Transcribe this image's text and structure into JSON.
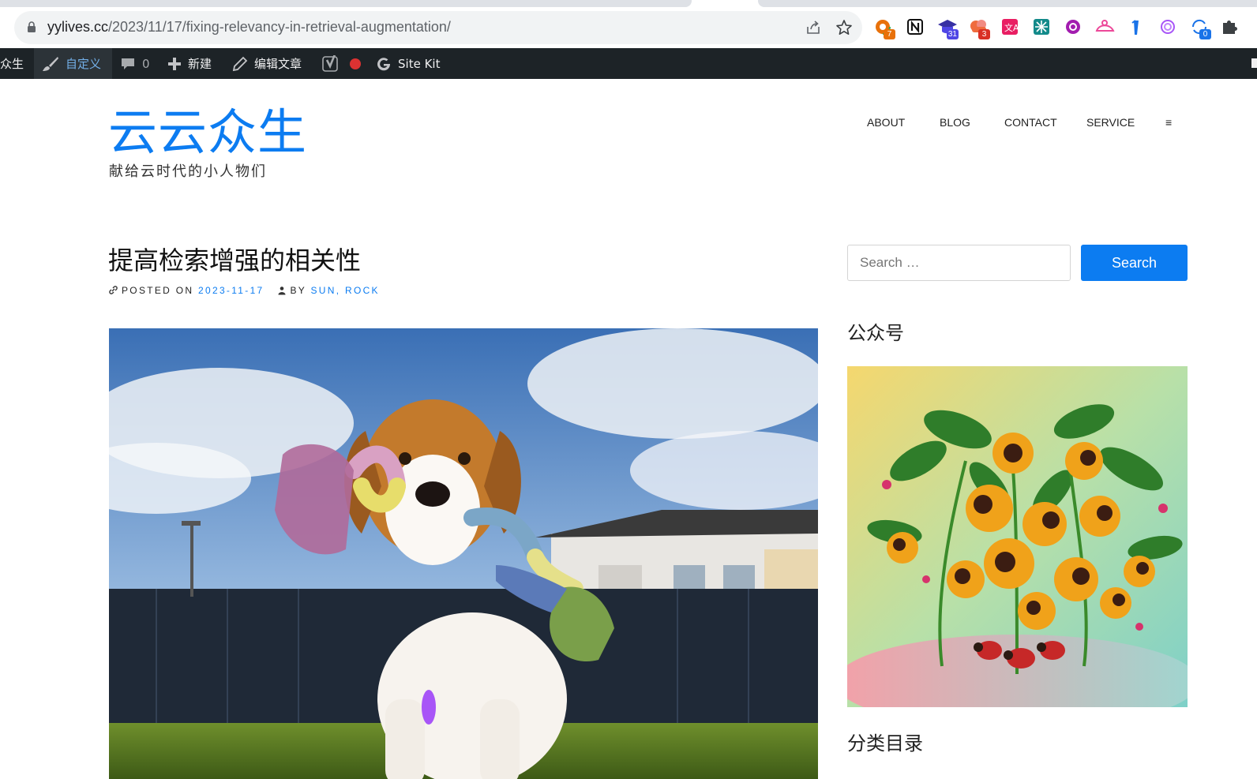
{
  "browser": {
    "url_host": "yylives.cc",
    "url_path": "/2023/11/17/fixing-relevancy-in-retrieval-augmentation/",
    "extensions": [
      {
        "name": "ext-orange-circle-icon",
        "badge": "7",
        "badge_color": "#e8710a"
      },
      {
        "name": "notion-icon",
        "badge": ""
      },
      {
        "name": "grad-cap-icon",
        "badge": "31",
        "badge_color": "#4f46e5"
      },
      {
        "name": "cloud-icon",
        "badge": "3",
        "badge_color": "#d93025"
      },
      {
        "name": "translate-icon",
        "badge": ""
      },
      {
        "name": "grid-app-icon",
        "badge": ""
      },
      {
        "name": "purple-circle-icon",
        "badge": ""
      },
      {
        "name": "pink-hat-icon",
        "badge": ""
      },
      {
        "name": "blue-bar-icon",
        "badge": ""
      },
      {
        "name": "openai-icon",
        "badge": ""
      },
      {
        "name": "sync-icon",
        "badge": "0",
        "badge_color": "#1a73e8"
      },
      {
        "name": "puzzle-icon",
        "badge": ""
      }
    ]
  },
  "adminbar": {
    "site_name": "众生",
    "customize_label": "自定义",
    "comments_count": "0",
    "new_label": "新建",
    "edit_label": "编辑文章",
    "sitekit_label": "Site Kit"
  },
  "site": {
    "title": "云云众生",
    "tagline": "献给云时代的小人物们",
    "accent_color": "#0c7cf1"
  },
  "nav": {
    "items": [
      "ABOUT",
      "BLOG",
      "CONTACT",
      "SERVICE"
    ],
    "menu_glyph": "≡"
  },
  "post": {
    "title": "提高检索增强的相关性",
    "posted_on_label": "POSTED ON",
    "date": "2023-11-17",
    "by_label": "BY",
    "authors": "SUN, ROCK"
  },
  "sidebar": {
    "search_placeholder": "Search …",
    "search_button": "Search",
    "widget1_title": "公众号",
    "widget2_title": "分类目录"
  }
}
